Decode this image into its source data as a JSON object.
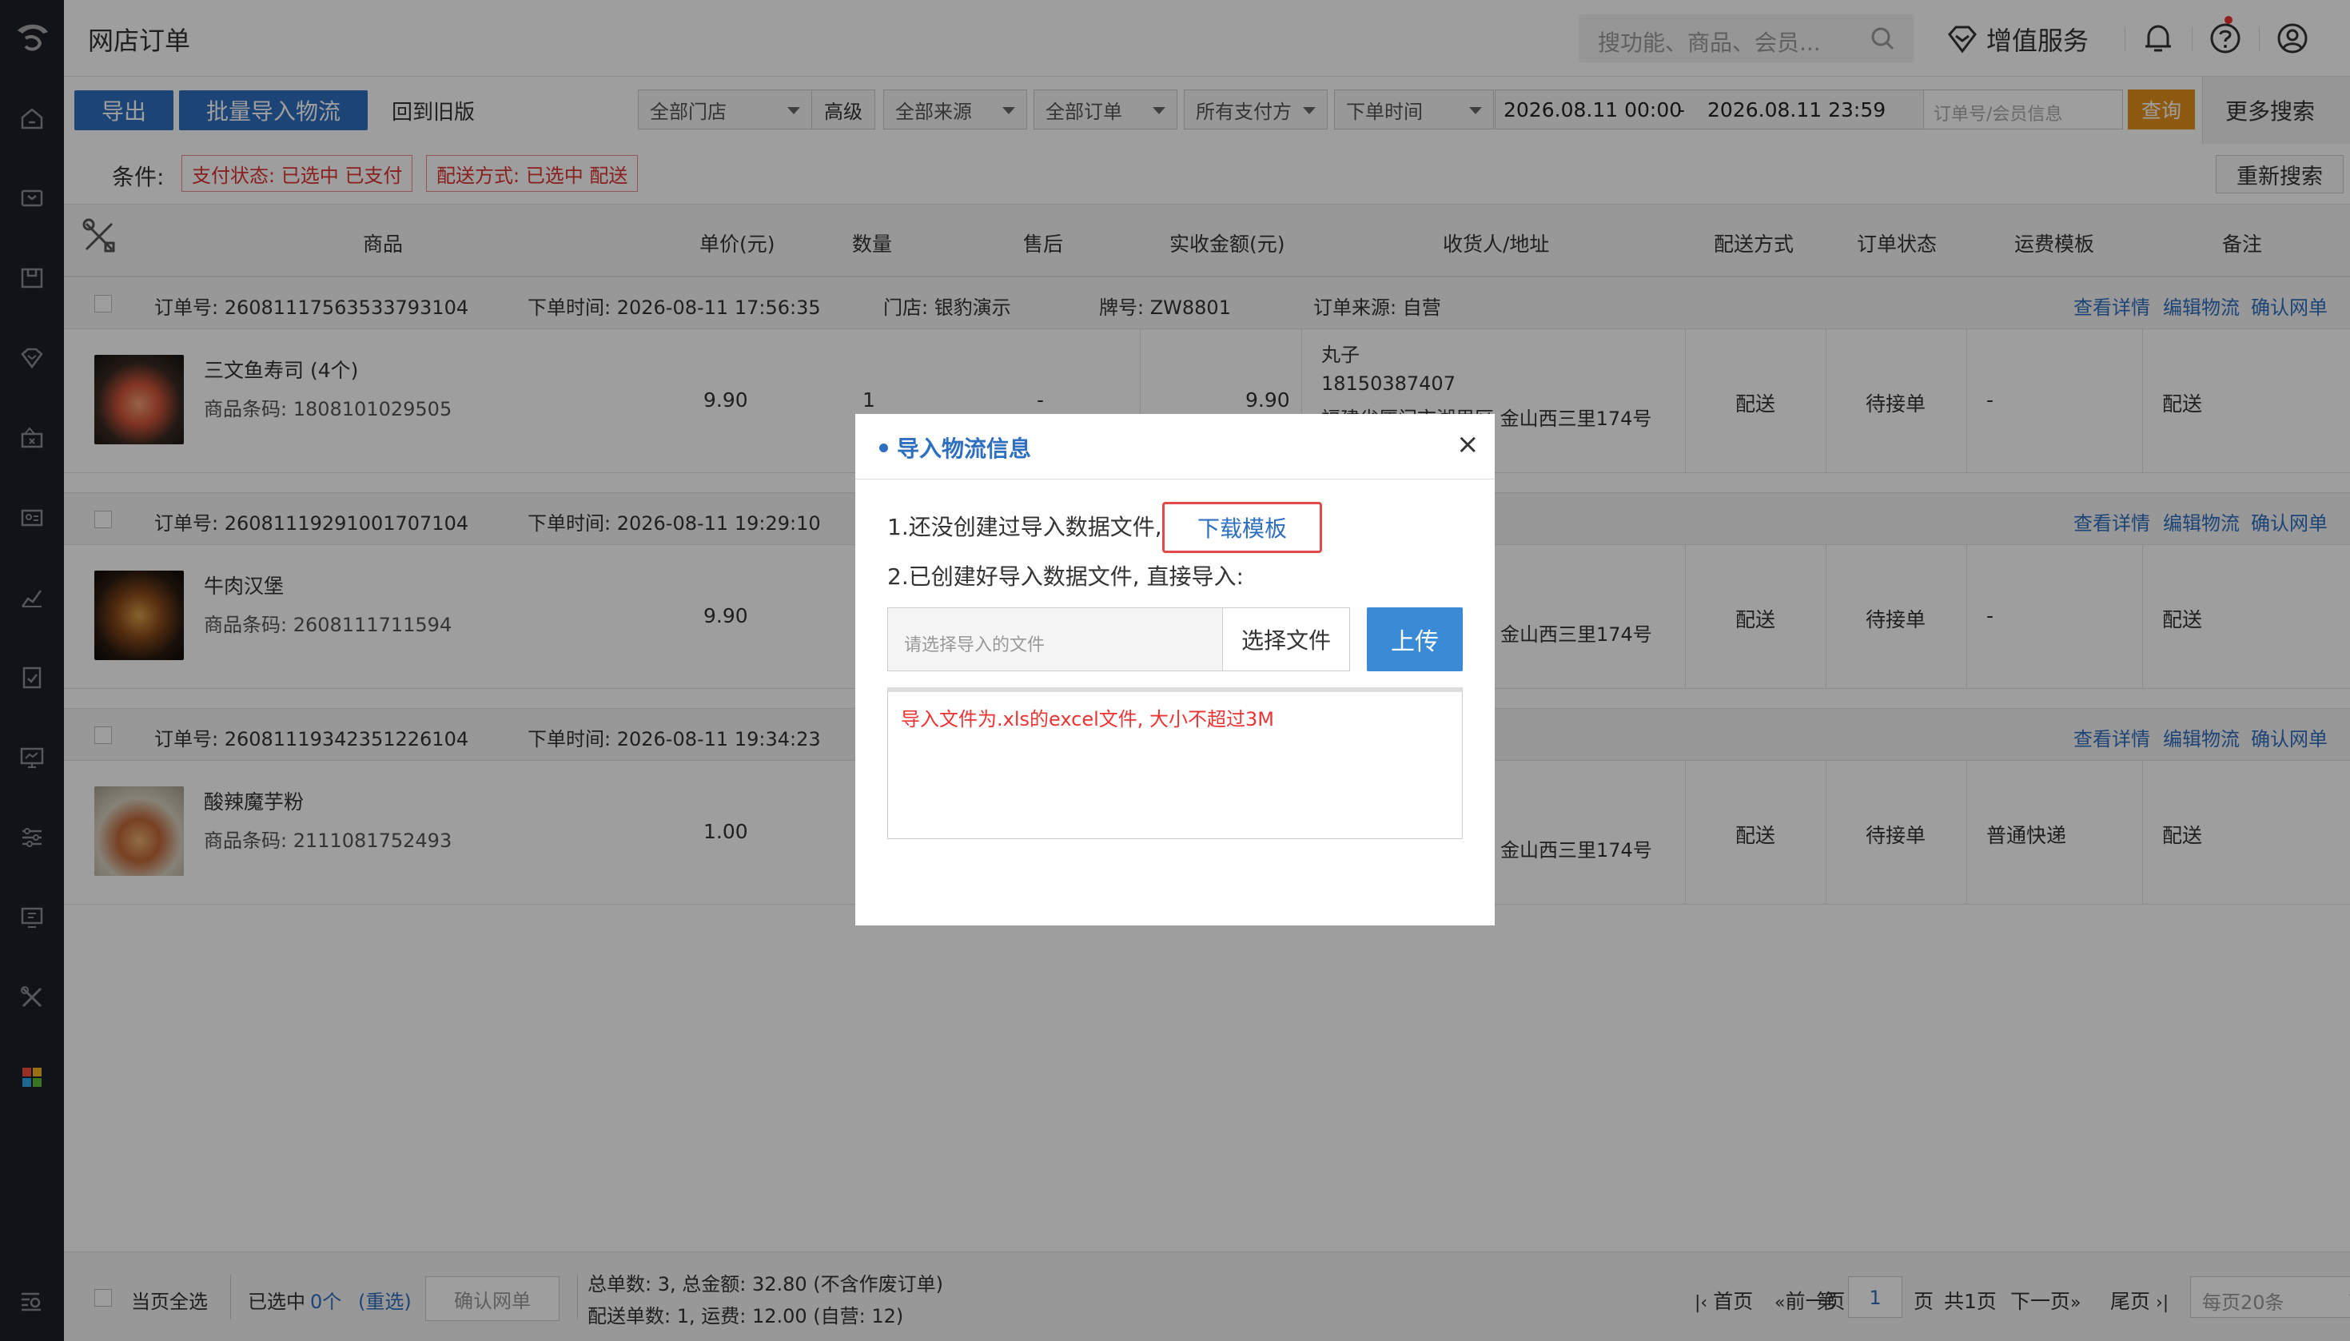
{
  "app": {
    "title": "网店订单"
  },
  "header": {
    "search_placeholder": "搜功能、商品、会员...",
    "vip_label": "增值服务",
    "icons": [
      "search-icon",
      "diamond-icon",
      "bell-icon",
      "help-icon",
      "user-icon"
    ]
  },
  "sidebar": {
    "icons": [
      "logo-icon",
      "home-icon",
      "cashier-icon",
      "product-icon",
      "member-icon",
      "purchase-icon",
      "card-icon",
      "report-icon",
      "audit-icon",
      "monitor-icon",
      "settings-icon",
      "device-icon",
      "tools-icon",
      "apps-icon",
      "search-list-icon"
    ]
  },
  "toolbar": {
    "export_label": "导出",
    "batch_import_label": "批量导入物流",
    "old_version_label": "回到旧版",
    "store_select": "全部门店",
    "advanced_label": "高级",
    "source_select": "全部来源",
    "order_select": "全部订单",
    "pay_select": "所有支付方",
    "time_select": "下单时间",
    "date_from": "2026.08.11 00:00",
    "date_sep": "-",
    "date_to": "2026.08.11 23:59",
    "order_input_placeholder": "订单号/会员信息",
    "query_label": "查询",
    "more_search_label": "更多搜索",
    "close_label": "✕"
  },
  "conditions": {
    "label": "条件:",
    "tags": [
      "支付状态: 已选中 已支付",
      "配送方式: 已选中 配送"
    ],
    "re_search_label": "重新搜索"
  },
  "table": {
    "headers": [
      "商品",
      "单价(元)",
      "数量",
      "售后",
      "实收金额(元)",
      "收货人/地址",
      "配送方式",
      "订单状态",
      "运费模板",
      "备注"
    ]
  },
  "orders": [
    {
      "order_no": "订单号: 26081117563533793104",
      "order_time": "下单时间: 2026-08-11 17:56:35",
      "store": "门店: 银豹演示",
      "plate": "牌号: ZW8801",
      "source": "订单来源: 自营",
      "actions": [
        "查看详情",
        "编辑物流",
        "确认网单"
      ],
      "product_name": "三文鱼寿司 (4个)",
      "product_code": "商品条码: 1808101029505",
      "unit_price": "9.90",
      "qty": "1",
      "after_sale": "-",
      "amount": "9.90",
      "receiver_name": "丸子",
      "receiver_phone": "18150387407",
      "receiver_address": "福建省厦门市湖里区 金山西三里174号",
      "delivery": "配送",
      "status": "待接单",
      "freight": "-",
      "remark": "配送"
    },
    {
      "order_no": "订单号: 26081119291001707104",
      "order_time": "下单时间: 2026-08-11 19:29:10",
      "actions": [
        "查看详情",
        "编辑物流",
        "确认网单"
      ],
      "product_name": "牛肉汉堡",
      "product_code": "商品条码: 2608111711594",
      "unit_price": "9.90",
      "receiver_address": "金山西三里174号",
      "delivery": "配送",
      "status": "待接单",
      "freight": "-",
      "remark": "配送"
    },
    {
      "order_no": "订单号: 26081119342351226104",
      "order_time": "下单时间: 2026-08-11 19:34:23",
      "actions": [
        "查看详情",
        "编辑物流",
        "确认网单"
      ],
      "product_name": "酸辣魔芋粉",
      "product_code": "商品条码: 2111081752493",
      "unit_price": "1.00",
      "receiver_address": "金山西三里174号",
      "delivery": "配送",
      "status": "待接单",
      "freight": "普通快递",
      "remark": "配送"
    }
  ],
  "modal": {
    "title": "导入物流信息",
    "close_label": "×",
    "step1": "1.还没创建过导入数据文件,",
    "download_label": "下载模板",
    "step2": "2.已创建好导入数据文件, 直接导入:",
    "file_placeholder": "请选择导入的文件",
    "choose_label": "选择文件",
    "upload_label": "上传",
    "message": "导入文件为.xls的excel文件, 大小不超过3M"
  },
  "footer": {
    "select_all_label": "当页全选",
    "selected_prefix": "已选中",
    "selected_count": "0个",
    "reselect_label": "(重选)",
    "confirm_label": "确认网单",
    "summary1": "总单数: 3, 总金额: 32.80 (不含作废订单)",
    "summary2": "配送单数: 1, 运费: 12.00 (自营: 12)",
    "first_label": "首页",
    "prev_label": "前一页",
    "page_prefix": "第",
    "page_value": "1",
    "page_suffix": "页",
    "total_pages": "共1页",
    "next_label": "下一页",
    "last_label": "尾页",
    "per_page_label": "每页20条"
  },
  "colors": {
    "primary": "#2f6fc0",
    "sidebar_bg": "#1e2027",
    "query_orange": "#e6921e",
    "danger": "#e24a4a"
  }
}
